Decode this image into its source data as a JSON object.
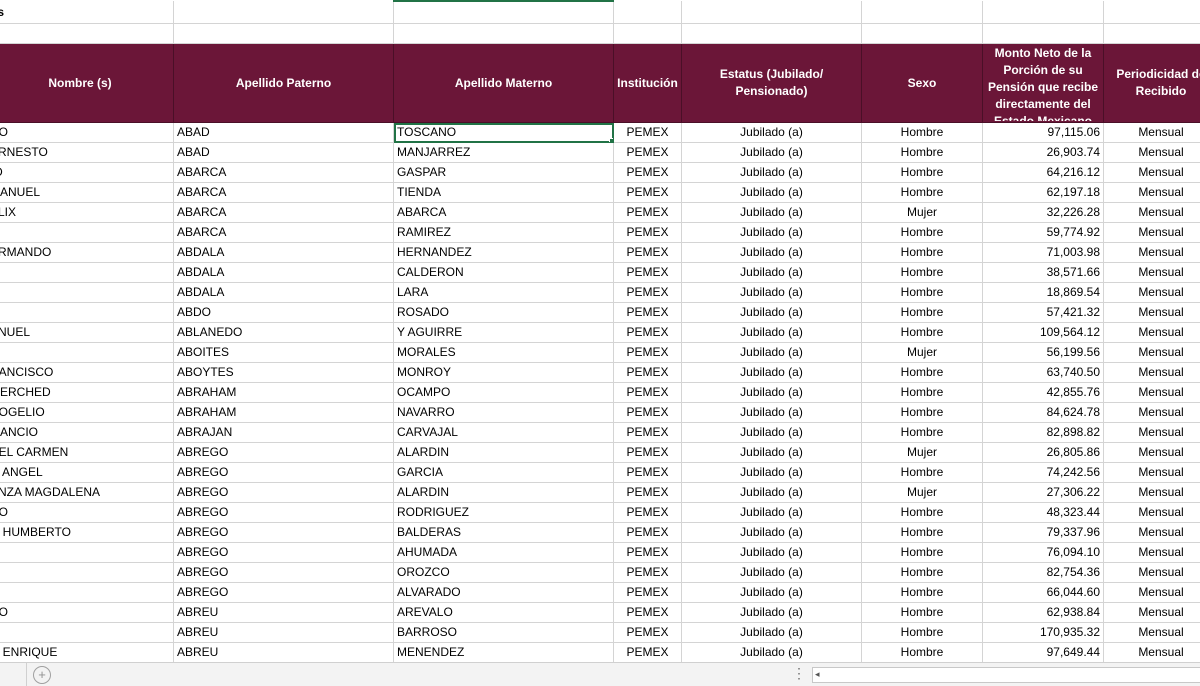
{
  "sheet": {
    "title": "os",
    "headers": {
      "nombre": "Nombre (s)",
      "apellido_paterno": "Apellido Paterno",
      "apellido_materno": "Apellido Materno",
      "institucion": "Institución",
      "estatus": "Estatus (Jubilado/ Pensionado)",
      "sexo": "Sexo",
      "monto": "Monto Neto de la Porción de su Pensión que recibe directamente del Estado Mexicano",
      "periodicidad": "Periodicidad de Recibido"
    },
    "rows": [
      {
        "nombre": "DO",
        "paterno": "ABAD",
        "materno": "TOSCANO",
        "inst": "PEMEX",
        "estatus": "Jubilado (a)",
        "sexo": "Hombre",
        "monto": "97,115.06",
        "period": "Mensual"
      },
      {
        "nombre": "ERNESTO",
        "paterno": "ABAD",
        "materno": "MANJARREZ",
        "inst": "PEMEX",
        "estatus": "Jubilado (a)",
        "sexo": "Hombre",
        "monto": "26,903.74",
        "period": "Mensual"
      },
      {
        "nombre": "IO",
        "paterno": "ABARCA",
        "materno": "GASPAR",
        "inst": "PEMEX",
        "estatus": "Jubilado (a)",
        "sexo": "Hombre",
        "monto": "64,216.12",
        "period": "Mensual"
      },
      {
        "nombre": " MANUEL",
        "paterno": "ABARCA",
        "materno": "TIENDA",
        "inst": "PEMEX",
        "estatus": "Jubilado (a)",
        "sexo": "Hombre",
        "monto": "62,197.18",
        "period": "Mensual"
      },
      {
        "nombre": "ELIX",
        "paterno": "ABARCA",
        "materno": "ABARCA",
        "inst": "PEMEX",
        "estatus": "Jubilado (a)",
        "sexo": "Mujer",
        "monto": "32,226.28",
        "period": "Mensual"
      },
      {
        "nombre": "",
        "paterno": "ABARCA",
        "materno": "RAMIREZ",
        "inst": "PEMEX",
        "estatus": "Jubilado (a)",
        "sexo": "Hombre",
        "monto": "59,774.92",
        "period": "Mensual"
      },
      {
        "nombre": "ARMANDO",
        "paterno": "ABDALA",
        "materno": "HERNANDEZ",
        "inst": "PEMEX",
        "estatus": "Jubilado (a)",
        "sexo": "Hombre",
        "monto": "71,003.98",
        "period": "Mensual"
      },
      {
        "nombre": "",
        "paterno": "ABDALA",
        "materno": "CALDERON",
        "inst": "PEMEX",
        "estatus": "Jubilado (a)",
        "sexo": "Hombre",
        "monto": "38,571.66",
        "period": "Mensual"
      },
      {
        "nombre": "",
        "paterno": "ABDALA",
        "materno": "LARA",
        "inst": "PEMEX",
        "estatus": "Jubilado (a)",
        "sexo": "Hombre",
        "monto": "18,869.54",
        "period": "Mensual"
      },
      {
        "nombre": "",
        "paterno": "ABDO",
        "materno": "ROSADO",
        "inst": "PEMEX",
        "estatus": "Jubilado (a)",
        "sexo": "Hombre",
        "monto": "57,421.32",
        "period": "Mensual"
      },
      {
        "nombre": "ANUEL",
        "paterno": "ABLANEDO",
        "materno": "Y AGUIRRE",
        "inst": "PEMEX",
        "estatus": "Jubilado (a)",
        "sexo": "Hombre",
        "monto": "109,564.12",
        "period": "Mensual"
      },
      {
        "nombre": "",
        "paterno": "ABOITES",
        "materno": "MORALES",
        "inst": "PEMEX",
        "estatus": "Jubilado (a)",
        "sexo": "Mujer",
        "monto": "56,199.56",
        "period": "Mensual"
      },
      {
        "nombre": "RANCISCO",
        "paterno": "ABOYTES",
        "materno": "MONROY",
        "inst": "PEMEX",
        "estatus": "Jubilado (a)",
        "sexo": "Hombre",
        "monto": "63,740.50",
        "period": "Mensual"
      },
      {
        "nombre": "MERCHED",
        "paterno": "ABRAHAM",
        "materno": "OCAMPO",
        "inst": "PEMEX",
        "estatus": "Jubilado (a)",
        "sexo": "Hombre",
        "monto": "42,855.76",
        "period": "Mensual"
      },
      {
        "nombre": "ROGELIO",
        "paterno": "ABRAHAM",
        "materno": "NAVARRO",
        "inst": "PEMEX",
        "estatus": "Jubilado (a)",
        "sexo": "Hombre",
        "monto": "84,624.78",
        "period": "Mensual"
      },
      {
        "nombre": "MANCIO",
        "paterno": "ABRAJAN",
        "materno": "CARVAJAL",
        "inst": "PEMEX",
        "estatus": "Jubilado (a)",
        "sexo": "Hombre",
        "monto": "82,898.82",
        "period": "Mensual"
      },
      {
        "nombre": "DEL CARMEN",
        "paterno": "ABREGO",
        "materno": "ALARDIN",
        "inst": "PEMEX",
        "estatus": "Jubilado (a)",
        "sexo": "Mujer",
        "monto": "26,805.86",
        "period": "Mensual"
      },
      {
        "nombre": "O ANGEL",
        "paterno": "ABREGO",
        "materno": "GARCIA",
        "inst": "PEMEX",
        "estatus": "Jubilado (a)",
        "sexo": "Hombre",
        "monto": "74,242.56",
        "period": "Mensual"
      },
      {
        "nombre": "ANZA MAGDALENA",
        "paterno": "ABREGO",
        "materno": "ALARDIN",
        "inst": "PEMEX",
        "estatus": "Jubilado (a)",
        "sexo": "Mujer",
        "monto": "27,306.22",
        "period": "Mensual"
      },
      {
        "nombre": "DO",
        "paterno": "ABREGO",
        "materno": "RODRIGUEZ",
        "inst": "PEMEX",
        "estatus": "Jubilado (a)",
        "sexo": "Hombre",
        "monto": "48,323.44",
        "period": "Mensual"
      },
      {
        "nombre": "O HUMBERTO",
        "paterno": "ABREGO",
        "materno": "BALDERAS",
        "inst": "PEMEX",
        "estatus": "Jubilado (a)",
        "sexo": "Hombre",
        "monto": "79,337.96",
        "period": "Mensual"
      },
      {
        "nombre": "",
        "paterno": "ABREGO",
        "materno": "AHUMADA",
        "inst": "PEMEX",
        "estatus": "Jubilado (a)",
        "sexo": "Hombre",
        "monto": "76,094.10",
        "period": "Mensual"
      },
      {
        "nombre": "",
        "paterno": "ABREGO",
        "materno": "OROZCO",
        "inst": "PEMEX",
        "estatus": "Jubilado (a)",
        "sexo": "Hombre",
        "monto": "82,754.36",
        "period": "Mensual"
      },
      {
        "nombre": "",
        "paterno": "ABREGO",
        "materno": "ALVARADO",
        "inst": "PEMEX",
        "estatus": "Jubilado (a)",
        "sexo": "Hombre",
        "monto": "66,044.60",
        "period": "Mensual"
      },
      {
        "nombre": "DO",
        "paterno": "ABREU",
        "materno": "AREVALO",
        "inst": "PEMEX",
        "estatus": "Jubilado (a)",
        "sexo": "Hombre",
        "monto": "62,938.84",
        "period": "Mensual"
      },
      {
        "nombre": "",
        "paterno": "ABREU",
        "materno": "BARROSO",
        "inst": "PEMEX",
        "estatus": "Jubilado (a)",
        "sexo": "Hombre",
        "monto": "170,935.32",
        "period": "Mensual"
      },
      {
        "nombre": "O ENRIQUE",
        "paterno": "ABREU",
        "materno": "MENENDEZ",
        "inst": "PEMEX",
        "estatus": "Jubilado (a)",
        "sexo": "Hombre",
        "monto": "97,649.44",
        "period": "Mensual"
      }
    ]
  },
  "statusbar": {
    "add_sheet_symbol": "+",
    "dots": "⋮",
    "scroll_left_arrow": "◂"
  },
  "colors": {
    "header_bg": "#6b1638",
    "header_text": "#ffffff",
    "selection": "#217346"
  }
}
